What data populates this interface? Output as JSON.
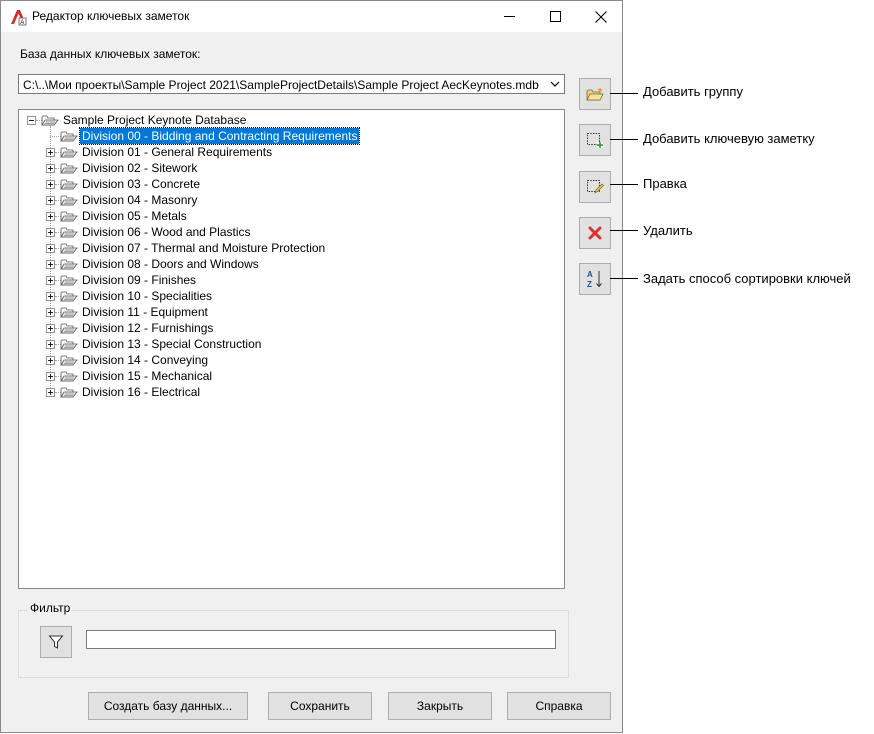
{
  "window": {
    "title": "Редактор ключевых заметок"
  },
  "database": {
    "label": "База данных ключевых заметок:",
    "path": "C:\\..\\Мои проекты\\Sample Project 2021\\SampleProjectDetails\\Sample Project AecKeynotes.mdb"
  },
  "tree": {
    "root": "Sample Project Keynote Database",
    "items": [
      {
        "label": "Division 00 - Bidding and Contracting Requirements",
        "selected": true,
        "expandable": false
      },
      {
        "label": "Division 01 - General Requirements",
        "expandable": true
      },
      {
        "label": "Division 02 - Sitework",
        "expandable": true
      },
      {
        "label": "Division 03 - Concrete",
        "expandable": true
      },
      {
        "label": "Division 04 - Masonry",
        "expandable": true
      },
      {
        "label": "Division 05 - Metals",
        "expandable": true
      },
      {
        "label": "Division 06 - Wood and Plastics",
        "expandable": true
      },
      {
        "label": "Division 07 - Thermal and Moisture Protection",
        "expandable": true
      },
      {
        "label": "Division 08 - Doors and Windows",
        "expandable": true
      },
      {
        "label": "Division 09 - Finishes",
        "expandable": true
      },
      {
        "label": "Division 10 - Specialities",
        "expandable": true
      },
      {
        "label": "Division 11 - Equipment",
        "expandable": true
      },
      {
        "label": "Division 12 - Furnishings",
        "expandable": true
      },
      {
        "label": "Division 13 - Special Construction",
        "expandable": true
      },
      {
        "label": "Division 14 - Conveying",
        "expandable": true
      },
      {
        "label": "Division 15 - Mechanical",
        "expandable": true
      },
      {
        "label": "Division 16 - Electrical",
        "expandable": true
      }
    ]
  },
  "callouts": {
    "add_group": "Добавить группу",
    "add_keynote": "Добавить ключевую заметку",
    "edit": "Правка",
    "delete": "Удалить",
    "sort": "Задать способ сортировки ключей"
  },
  "filter": {
    "label": "Фильтр",
    "value": ""
  },
  "buttons": {
    "create_db": "Создать базу данных...",
    "save": "Сохранить",
    "close": "Закрыть",
    "help": "Справка"
  },
  "colors": {
    "selection": "#0078d7",
    "window_bg": "#f0f0f0",
    "delete_red": "#e0302c"
  }
}
